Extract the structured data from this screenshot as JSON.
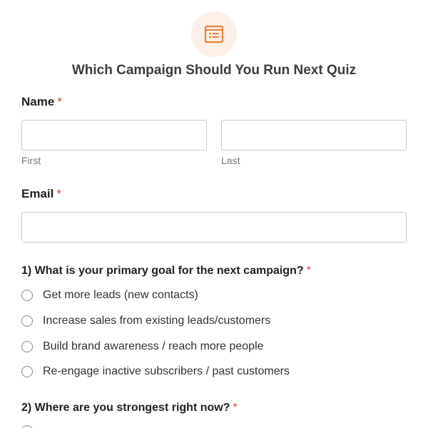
{
  "header": {
    "icon": "form-list-icon",
    "icon_color": "#e8813f",
    "icon_bg": "#fdf0e8",
    "title": "Which Campaign Should You Run Next Quiz"
  },
  "required_marker": "*",
  "required_color": "#d9443a",
  "name_field": {
    "label": "Name",
    "first_value": "",
    "first_sublabel": "First",
    "last_value": "",
    "last_sublabel": "Last"
  },
  "email_field": {
    "label": "Email",
    "value": ""
  },
  "question1": {
    "label": "1) What is your primary goal for the next campaign?",
    "options": [
      "Get more leads (new contacts)",
      "Increase sales from existing leads/customers",
      "Build brand awareness / reach more people",
      "Re-engage inactive subscribers / past customers"
    ]
  },
  "question2": {
    "label": "2) Where are you strongest right now?"
  }
}
